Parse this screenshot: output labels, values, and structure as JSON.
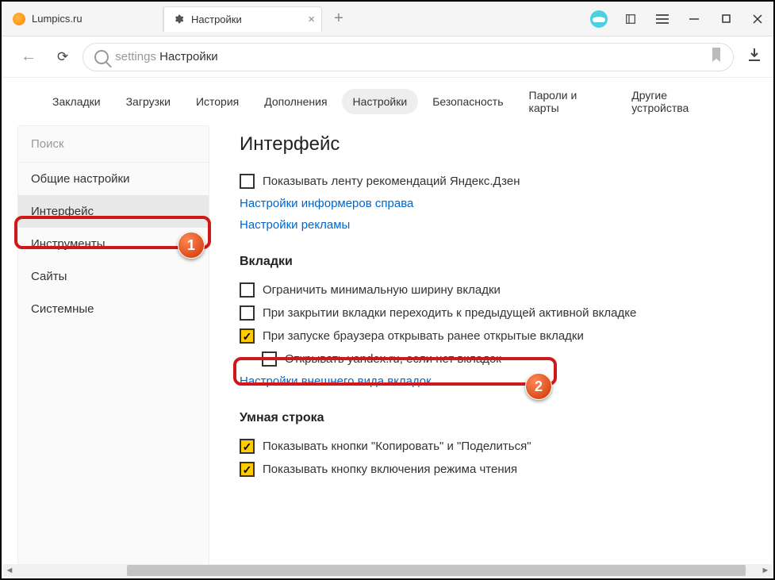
{
  "tabs": [
    {
      "label": "Lumpics.ru"
    },
    {
      "label": "Настройки"
    }
  ],
  "addressbar": {
    "prefix": "settings",
    "title": "Настройки"
  },
  "topnav": {
    "items": [
      "Закладки",
      "Загрузки",
      "История",
      "Дополнения",
      "Настройки",
      "Безопасность",
      "Пароли и карты",
      "Другие устройства"
    ],
    "activeIndex": 4
  },
  "sidebar": {
    "search_placeholder": "Поиск",
    "items": [
      "Общие настройки",
      "Интерфейс",
      "Инструменты",
      "Сайты",
      "Системные"
    ],
    "selectedIndex": 1
  },
  "main": {
    "heading": "Интерфейс",
    "zen_check": "Показывать ленту рекомендаций Яндекс.Дзен",
    "link_informers": "Настройки информеров справа",
    "link_ads": "Настройки рекламы",
    "tabs_heading": "Вкладки",
    "tab_check1": "Ограничить минимальную ширину вкладки",
    "tab_check2": "При закрытии вкладки переходить к предыдущей активной вкладке",
    "tab_check3": "При запуске браузера открывать ранее открытые вкладки",
    "tab_check4": "Открывать yandex.ru, если нет вкладок",
    "link_tabs_appearance": "Настройки внешнего вида вкладок",
    "smartbar_heading": "Умная строка",
    "smart_check1": "Показывать кнопки \"Копировать\" и \"Поделиться\"",
    "smart_check2": "Показывать кнопку включения режима чтения"
  },
  "badges": {
    "one": "1",
    "two": "2"
  }
}
